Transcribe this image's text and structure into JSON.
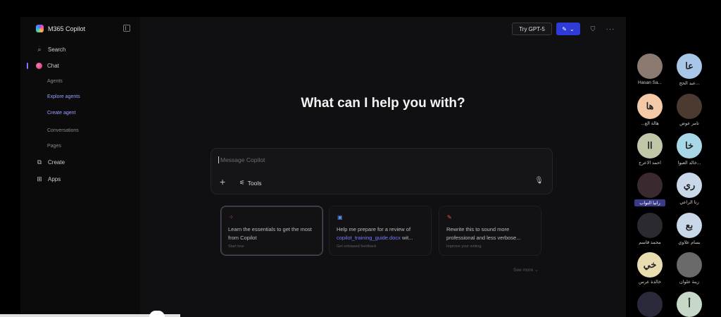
{
  "sidebar": {
    "app_title": "M365 Copilot",
    "search_label": "Search",
    "chat_label": "Chat",
    "agents_label": "Agents",
    "explore_agents_label": "Explore agents",
    "create_agent_label": "Create agent",
    "conversations_label": "Conversations",
    "pages_label": "Pages",
    "create_label": "Create",
    "apps_label": "Apps"
  },
  "topbar": {
    "try_label": "Try GPT-5"
  },
  "main": {
    "headline": "What can I help you with?",
    "composer_placeholder": "Message Copilot",
    "tools_label": "Tools",
    "see_more_label": "See more"
  },
  "cards": [
    {
      "text": "Learn the essentials to get the most from Copilot",
      "sub": "Start tour"
    },
    {
      "text_prefix": "Help me prepare for a review of ",
      "file": "copilot_training_guide.docx",
      "text_suffix": " wit...",
      "sub": "Get unbiased feedback"
    },
    {
      "text": "Rewrite this to sound more professional and less verbose...",
      "sub": "Improve your writing"
    }
  ],
  "participants": [
    {
      "name": "Hasan Sa...",
      "initials": "",
      "bg": "#8a7a70"
    },
    {
      "name": "عبد الحج...",
      "initials": "عا",
      "bg": "#a8c6e8"
    },
    {
      "name": "...هالة الع",
      "initials": "ها",
      "bg": "#f3c9a8"
    },
    {
      "name": "تامر عوض",
      "initials": "",
      "bg": "#4a3a30"
    },
    {
      "name": "احمد الاعرج",
      "initials": "اا",
      "bg": "#bfc7a8"
    },
    {
      "name": "خالد العبوا...",
      "initials": "خا",
      "bg": "#a8d8e8"
    },
    {
      "name": "رانيا النواب",
      "initials": "",
      "bg": "#3a2a30"
    },
    {
      "name": "رنا الراعي",
      "initials": "ري",
      "bg": "#c8d8e8"
    },
    {
      "name": "محمد قاسم",
      "initials": "",
      "bg": "#2a2a30"
    },
    {
      "name": "بسام علاوي",
      "initials": "بع",
      "bg": "#c8d8e8"
    },
    {
      "name": "خالدة عرس",
      "initials": "خي",
      "bg": "#e8dcb0"
    },
    {
      "name": "زينة علوان",
      "initials": "",
      "bg": "#6a6a6a"
    },
    {
      "name": "",
      "initials": "",
      "bg": "#2a2a3a"
    },
    {
      "name": "",
      "initials": "أ",
      "bg": "#c8d8c8"
    }
  ]
}
